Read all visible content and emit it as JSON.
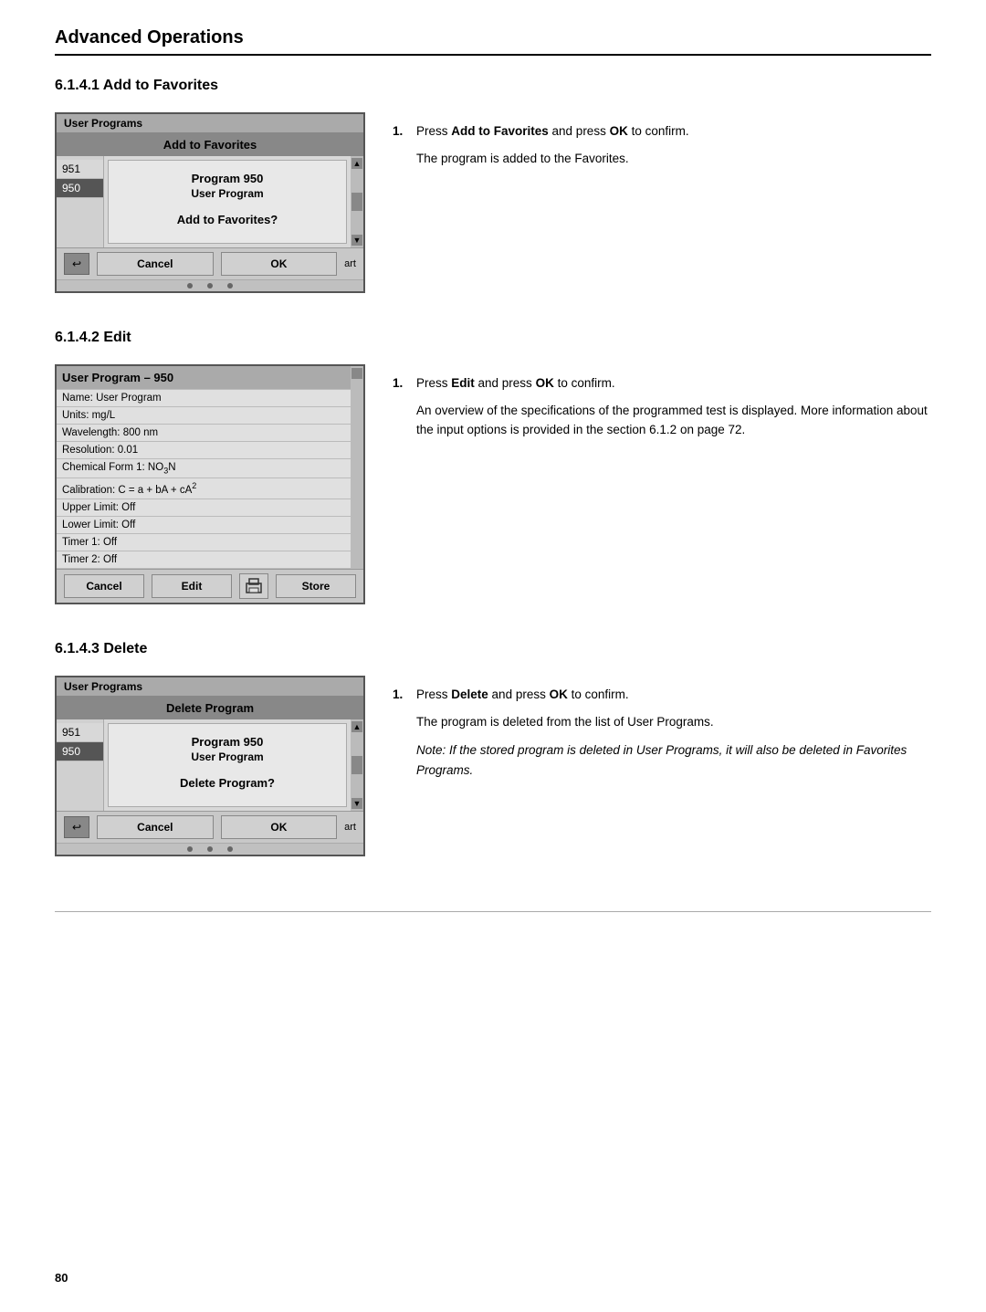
{
  "page": {
    "title": "Advanced Operations",
    "page_number": "80"
  },
  "sections": [
    {
      "id": "add_to_favorites",
      "title": "6.1.4.1  Add to Favorites",
      "screen": {
        "header_partial": "User Programs",
        "dialog_title": "Add to Favorites",
        "list_items": [
          "951",
          "950"
        ],
        "selected_item": "950",
        "program_number": "Program 950",
        "program_type": "User Program",
        "prompt": "Add to Favorites?",
        "buttons": [
          "Cancel",
          "OK"
        ]
      },
      "instructions": [
        {
          "step": 1,
          "text_parts": [
            {
              "type": "text",
              "content": "Press "
            },
            {
              "type": "bold",
              "content": "Add to Favorites"
            },
            {
              "type": "text",
              "content": " and press "
            },
            {
              "type": "bold",
              "content": "OK"
            },
            {
              "type": "text",
              "content": " to confirm."
            }
          ]
        },
        {
          "step": null,
          "plain": "The program is added to the Favorites."
        }
      ]
    },
    {
      "id": "edit",
      "title": "6.1.4.2  Edit",
      "screen": {
        "header": "User Program – 950",
        "rows": [
          "Name: User Program",
          "Units: mg/L",
          "Wavelength: 800 nm",
          "Resolution: 0.01",
          "Chemical Form 1: NO₃N",
          "Calibration: C = a + bA + cA²",
          "Upper Limit: Off",
          "Lower Limit: Off",
          "Timer 1: Off",
          "Timer 2: Off"
        ],
        "buttons": [
          "Cancel",
          "Edit",
          "icon:box",
          "Store"
        ]
      },
      "instructions": [
        {
          "step": 1,
          "text_parts": [
            {
              "type": "text",
              "content": "Press "
            },
            {
              "type": "bold",
              "content": "Edit"
            },
            {
              "type": "text",
              "content": " and press "
            },
            {
              "type": "bold",
              "content": "OK"
            },
            {
              "type": "text",
              "content": " to confirm."
            }
          ]
        },
        {
          "step": null,
          "plain": "An overview of the specifications of the programmed test is displayed. More information about the input options is provided in the section 6.1.2 on page 72."
        }
      ]
    },
    {
      "id": "delete",
      "title": "6.1.4.3  Delete",
      "screen": {
        "header_partial": "User Programs",
        "dialog_title": "Delete Program",
        "list_items": [
          "951",
          "950"
        ],
        "selected_item": "950",
        "program_number": "Program 950",
        "program_type": "User Program",
        "prompt": "Delete Program?",
        "buttons": [
          "Cancel",
          "OK"
        ]
      },
      "instructions": [
        {
          "step": 1,
          "text_parts": [
            {
              "type": "text",
              "content": "Press "
            },
            {
              "type": "bold",
              "content": "Delete"
            },
            {
              "type": "text",
              "content": " and press "
            },
            {
              "type": "bold",
              "content": "OK"
            },
            {
              "type": "text",
              "content": " to confirm."
            }
          ]
        },
        {
          "step": null,
          "plain": "The program is deleted from the list of User Programs."
        },
        {
          "step": null,
          "note": true,
          "plain": "Note: If the stored program is deleted in User Programs, it will also be deleted in Favorites Programs."
        }
      ]
    }
  ]
}
